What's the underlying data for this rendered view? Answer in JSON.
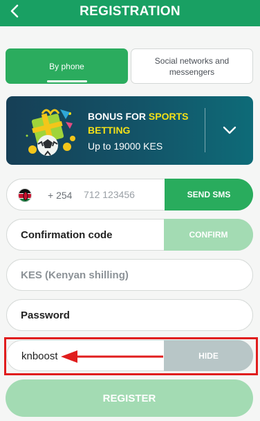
{
  "header": {
    "title": "REGISTRATION"
  },
  "tabs": [
    {
      "label": "By phone",
      "active": true
    },
    {
      "label": "Social networks and messengers",
      "active": false
    }
  ],
  "bonus": {
    "title_plain": "BONUS FOR ",
    "title_accent": "SPORTS BETTING",
    "subtitle": "Up to 19000 KES"
  },
  "phone": {
    "flag": "kenya-flag",
    "country_code": "+ 254",
    "placeholder": "712 123456",
    "send_label": "SEND SMS"
  },
  "confirmation": {
    "placeholder": "Confirmation code",
    "confirm_label": "CONFIRM"
  },
  "currency": {
    "value": "KES (Kenyan shilling)"
  },
  "password": {
    "placeholder": "Password"
  },
  "password_visible": {
    "value": "knboost",
    "hide_label": "HIDE"
  },
  "register": {
    "label": "REGISTER"
  },
  "colors": {
    "brand_green": "#19a063",
    "button_green": "#29ac5d",
    "disabled_green": "#a3dbb3",
    "hide_gray": "#b8c6c7",
    "highlight_red": "#e01d1d",
    "bonus_accent": "#f3e018"
  }
}
